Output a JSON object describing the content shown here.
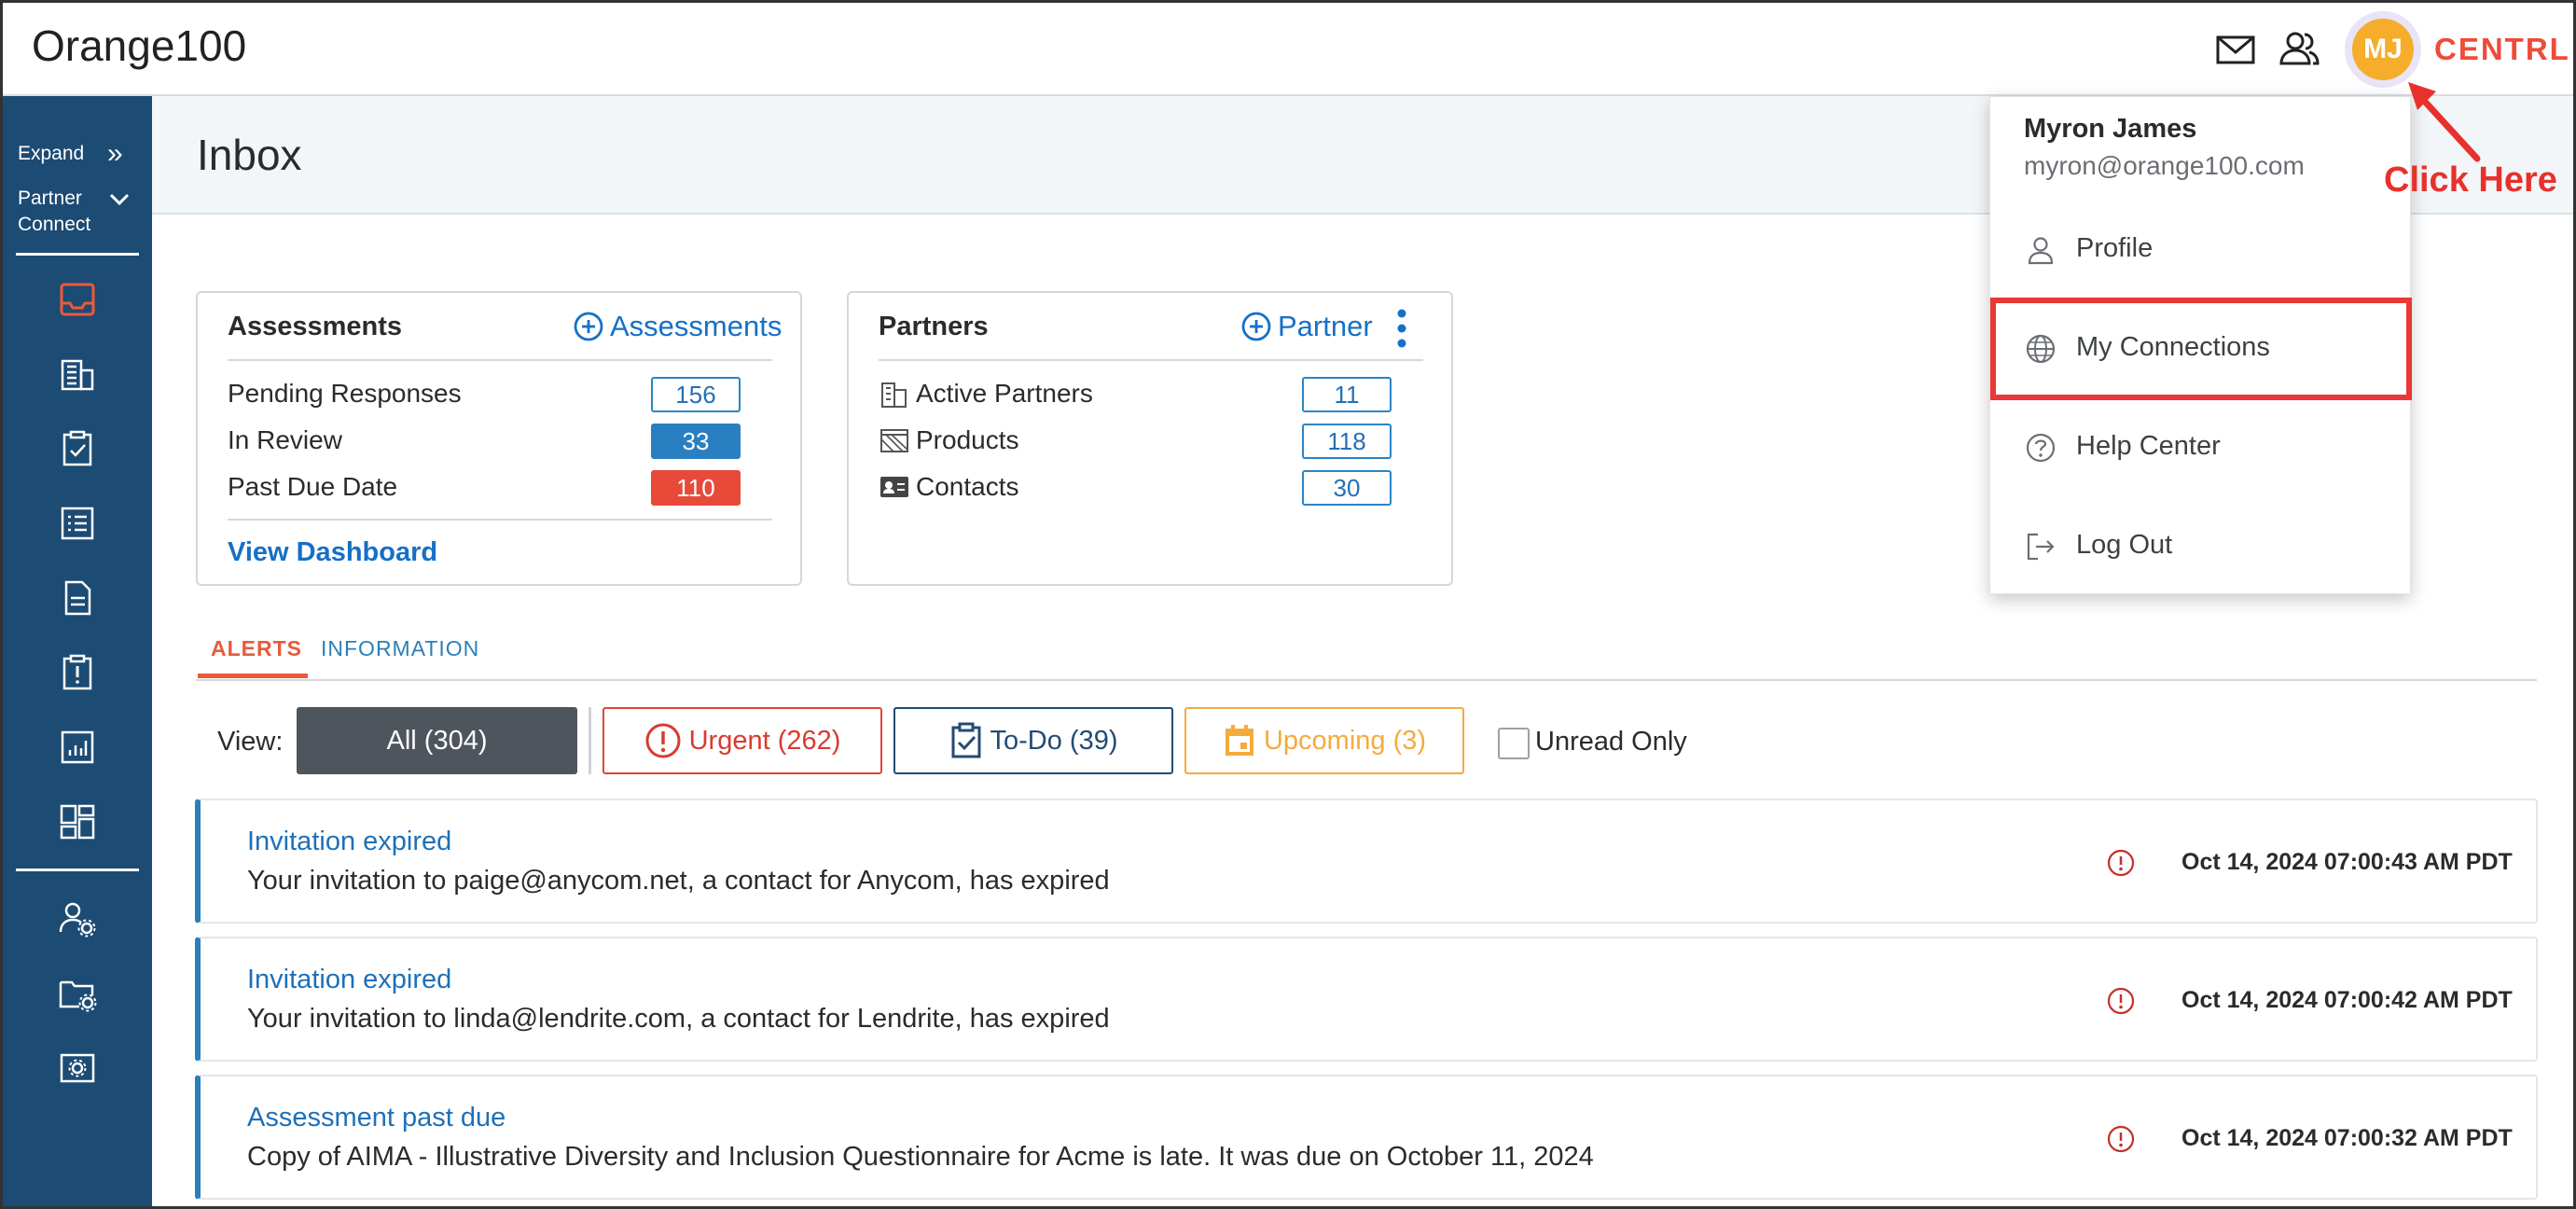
{
  "app": {
    "logo": "Orange100",
    "brand": "CENTRL"
  },
  "topbar": {
    "avatar_initials": "MJ",
    "mail_icon": "mail-icon",
    "users_icon": "users-icon"
  },
  "sidebar": {
    "expand_label": "Expand",
    "partner_label_1": "Partner",
    "partner_label_2": "Connect",
    "items": [
      {
        "icon": "inbox-icon"
      },
      {
        "icon": "building-icon"
      },
      {
        "icon": "clipboard-check-icon"
      },
      {
        "icon": "checklist-icon"
      },
      {
        "icon": "document-icon"
      },
      {
        "icon": "alert-clipboard-icon"
      },
      {
        "icon": "bar-chart-icon"
      },
      {
        "icon": "dashboard-icon"
      },
      {
        "icon": "user-settings-icon"
      },
      {
        "icon": "folder-settings-icon"
      },
      {
        "icon": "gear-box-icon"
      }
    ]
  },
  "page": {
    "title": "Inbox"
  },
  "assessments_card": {
    "title": "Assessments",
    "add_link": "Assessments",
    "rows": [
      {
        "label": "Pending Responses",
        "value": "156"
      },
      {
        "label": "In Review",
        "value": "33"
      },
      {
        "label": "Past Due Date",
        "value": "110"
      }
    ],
    "dashboard_link": "View Dashboard"
  },
  "partners_card": {
    "title": "Partners",
    "add_link": "Partner",
    "rows": [
      {
        "label": "Active Partners",
        "value": "11"
      },
      {
        "label": "Products",
        "value": "118"
      },
      {
        "label": "Contacts",
        "value": "30"
      }
    ]
  },
  "tabs": [
    {
      "label": "ALERTS"
    },
    {
      "label": "INFORMATION"
    }
  ],
  "filters": {
    "view_label": "View:",
    "all": "All (304)",
    "urgent": "Urgent (262)",
    "todo": "To-Do (39)",
    "upcoming": "Upcoming (3)",
    "unread": "Unread Only"
  },
  "alerts": [
    {
      "title": "Invitation expired",
      "body": "Your invitation to paige@anycom.net, a contact for Anycom, has expired",
      "time": "Oct 14, 2024 07:00:43 AM PDT"
    },
    {
      "title": "Invitation expired",
      "body": "Your invitation to linda@lendrite.com, a contact for Lendrite, has expired",
      "time": "Oct 14, 2024 07:00:42 AM PDT"
    },
    {
      "title": "Assessment past due",
      "body": "Copy of AIMA - Illustrative Diversity and Inclusion Questionnaire for Acme is late. It was due on October 11, 2024",
      "time": "Oct 14, 2024 07:00:32 AM PDT"
    }
  ],
  "user_menu": {
    "name": "Myron James",
    "email": "myron@orange100.com",
    "items": [
      {
        "label": "Profile",
        "icon": "person-icon"
      },
      {
        "label": "My Connections",
        "icon": "globe-icon"
      },
      {
        "label": "Help Center",
        "icon": "help-icon"
      },
      {
        "label": "Log Out",
        "icon": "logout-icon"
      }
    ]
  },
  "annotation": {
    "text": "Click Here"
  },
  "colors": {
    "sidebar": "#1c4b73",
    "accent": "#e85a3a",
    "link": "#1570c7",
    "highlight": "#ea3737",
    "avatar": "#f5ad2b"
  }
}
